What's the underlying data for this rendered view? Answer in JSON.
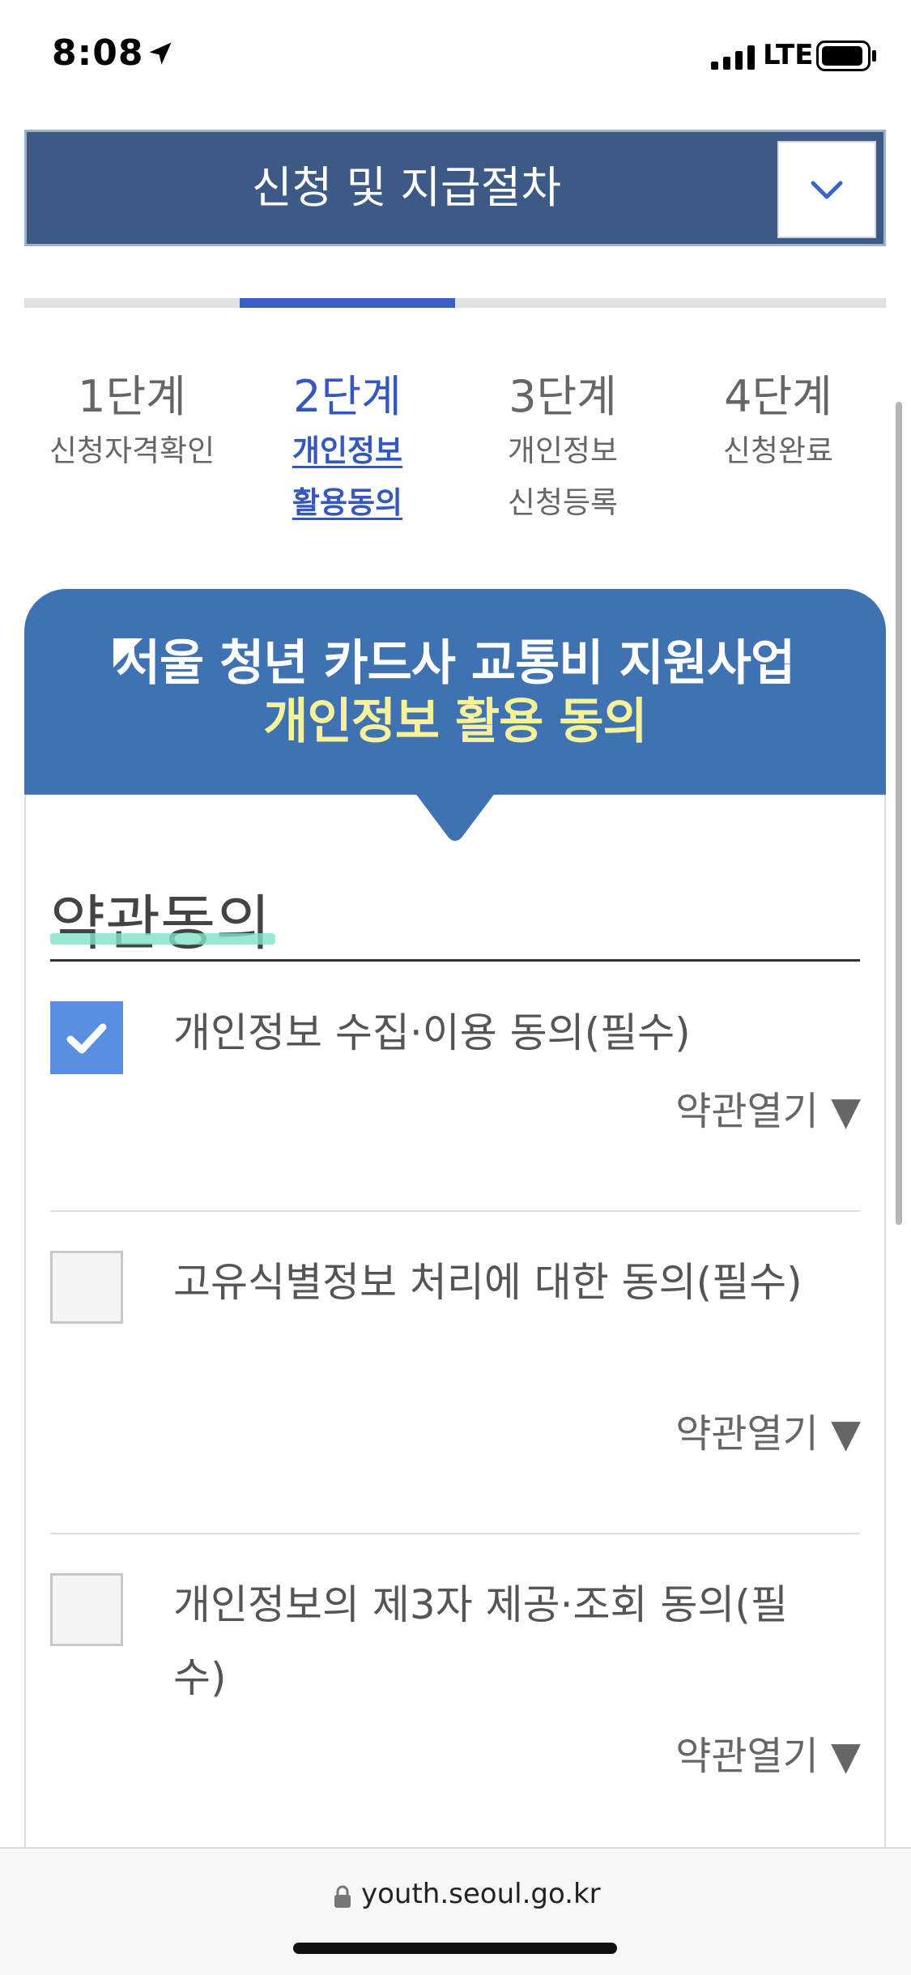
{
  "status_bar": {
    "time": "8:08",
    "network": "LTE"
  },
  "header": {
    "title": "신청 및 지급절차"
  },
  "progress": {
    "active_step": 2,
    "total_steps": 4
  },
  "steps": [
    {
      "num": "1단계",
      "label_line1": "신청자격확인",
      "label_line2": ""
    },
    {
      "num": "2단계",
      "label_line1": "개인정보",
      "label_line2": "활용동의"
    },
    {
      "num": "3단계",
      "label_line1": "개인정보",
      "label_line2": "신청등록"
    },
    {
      "num": "4단계",
      "label_line1": "신청완료",
      "label_line2": ""
    }
  ],
  "banner": {
    "line1": "서울 청년 카드사 교통비 지원사업",
    "line2": "개인정보 활용 동의"
  },
  "section": {
    "title": "약관동의"
  },
  "agreements": [
    {
      "text": "개인정보 수집·이용 동의(필수)",
      "checked": true,
      "open_label": "약관열기 ▼"
    },
    {
      "text": "고유식별정보 처리에 대한 동의(필수)",
      "checked": false,
      "open_label": "약관열기 ▼"
    },
    {
      "text": "개인정보의 제3자 제공·조회 동의(필수)",
      "checked": false,
      "open_label": "약관열기 ▼"
    }
  ],
  "browser": {
    "url": "youth.seoul.go.kr"
  },
  "colors": {
    "header_bg": "#3d5a86",
    "banner_bg": "#3f72b0",
    "accent_blue": "#3557c0",
    "banner_highlight": "#f7f29a",
    "checkbox_checked": "#5a8ee0"
  }
}
